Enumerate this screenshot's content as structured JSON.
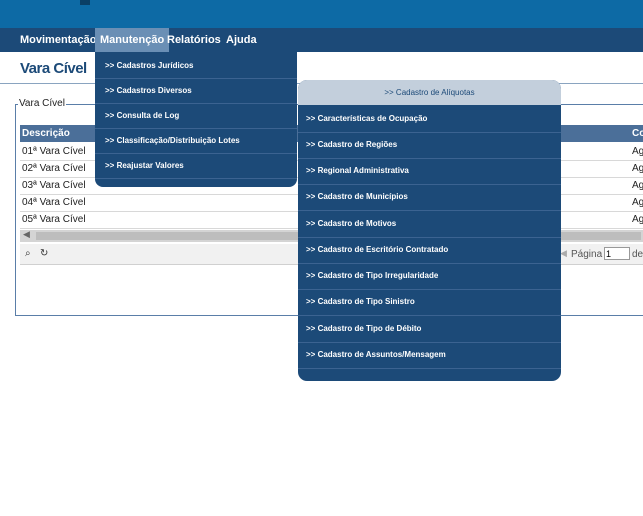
{
  "menubar": {
    "items": [
      {
        "label": "Movimentação"
      },
      {
        "label": "Manutenção"
      },
      {
        "label": "Relatórios"
      },
      {
        "label": "Ajuda"
      }
    ]
  },
  "page": {
    "title": "Vara Cível"
  },
  "fieldset": {
    "legend": "Vara Cível"
  },
  "grid": {
    "columns": [
      "Descrição",
      "Co"
    ],
    "rows": [
      [
        "01ª Vara Cível",
        "Ag"
      ],
      [
        "02ª Vara Cível",
        "Ag"
      ],
      [
        "03ª Vara Cível",
        "Ag"
      ],
      [
        "04ª Vara Cível",
        "Ag"
      ],
      [
        "05ª Vara Cível",
        "Ag"
      ]
    ],
    "pager": {
      "label": "Página",
      "value": "1",
      "of": "de"
    }
  },
  "dropdown": {
    "items": [
      {
        "label": ">> Cadastros Jurídicos"
      },
      {
        "label": ">> Cadastros Diversos"
      },
      {
        "label": ">> Consulta de Log"
      },
      {
        "label": ">> Classificação/Distribuição Lotes"
      },
      {
        "label": ">> Reajustar Valores"
      }
    ]
  },
  "submenu": {
    "header": ">> Cadastro de Alíquotas",
    "items": [
      {
        "label": ">> Características de Ocupação"
      },
      {
        "label": ">> Cadastro de Regiões"
      },
      {
        "label": ">> Regional Administrativa"
      },
      {
        "label": ">> Cadastro de Municípios"
      },
      {
        "label": ">> Cadastro de Motivos"
      },
      {
        "label": ">> Cadastro de Escritório Contratado"
      },
      {
        "label": ">> Cadastro de Tipo Irregularidade"
      },
      {
        "label": ">> Cadastro de Tipo Sinistro"
      },
      {
        "label": ">> Cadastro de Tipo de Débito"
      },
      {
        "label": ">> Cadastro de Assuntos/Mensagem"
      }
    ]
  },
  "colors": {
    "menu_bg": "#1c4a78",
    "topbar": "#0d6aa5",
    "active_menu": "#6a8fb5"
  },
  "icons": {
    "search": "search-icon",
    "refresh": "refresh-icon"
  }
}
